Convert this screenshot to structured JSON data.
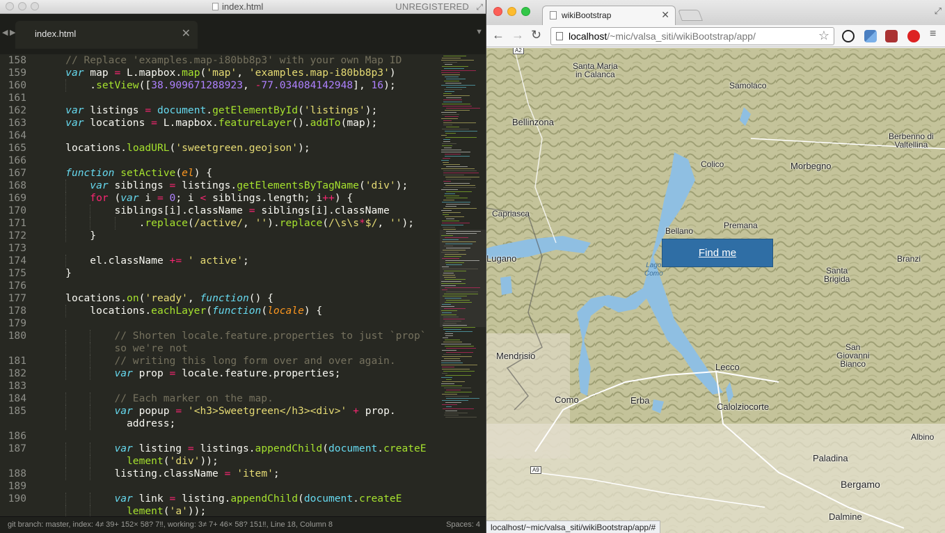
{
  "editor": {
    "window_title": "index.html",
    "unregistered": "UNREGISTERED",
    "tab_label": "index.html",
    "status": "git branch: master, index: 4≠ 39+ 152× 58? 7‼, working: 3≠ 7+ 46× 58? 151‼, Line 18, Column 8",
    "spaces": "Spaces: 4",
    "lines": [
      {
        "n": "158",
        "indent": 1,
        "tokens": [
          [
            "cm",
            "// Replace 'examples.map-i80bb8p3' with your own Map ID"
          ]
        ]
      },
      {
        "n": "159",
        "indent": 1,
        "tokens": [
          [
            "kw",
            "var"
          ],
          [
            "p",
            " map "
          ],
          [
            "op",
            "="
          ],
          [
            "p",
            " L.mapbox."
          ],
          [
            "fn",
            "map"
          ],
          [
            "p",
            "("
          ],
          [
            "str",
            "'map'"
          ],
          [
            "p",
            ", "
          ],
          [
            "str",
            "'examples.map-i80bb8p3'"
          ],
          [
            "p",
            ")"
          ]
        ]
      },
      {
        "n": "160",
        "indent": 2,
        "tokens": [
          [
            "p",
            "."
          ],
          [
            "fn",
            "setView"
          ],
          [
            "p",
            "(["
          ],
          [
            "num",
            "38.909671288923"
          ],
          [
            "p",
            ", "
          ],
          [
            "op",
            "-"
          ],
          [
            "num",
            "77.034084142948"
          ],
          [
            "p",
            "], "
          ],
          [
            "num",
            "16"
          ],
          [
            "p",
            ");"
          ]
        ]
      },
      {
        "n": "161",
        "indent": 0,
        "tokens": []
      },
      {
        "n": "162",
        "indent": 1,
        "tokens": [
          [
            "kw",
            "var"
          ],
          [
            "p",
            " listings "
          ],
          [
            "op",
            "="
          ],
          [
            "p",
            " "
          ],
          [
            "dom",
            "document"
          ],
          [
            "p",
            "."
          ],
          [
            "fn",
            "getElementById"
          ],
          [
            "p",
            "("
          ],
          [
            "str",
            "'listings'"
          ],
          [
            "p",
            ");"
          ]
        ]
      },
      {
        "n": "163",
        "indent": 1,
        "tokens": [
          [
            "kw",
            "var"
          ],
          [
            "p",
            " locations "
          ],
          [
            "op",
            "="
          ],
          [
            "p",
            " L.mapbox."
          ],
          [
            "fn",
            "featureLayer"
          ],
          [
            "p",
            "()."
          ],
          [
            "fn",
            "addTo"
          ],
          [
            "p",
            "(map);"
          ]
        ]
      },
      {
        "n": "164",
        "indent": 0,
        "tokens": []
      },
      {
        "n": "165",
        "indent": 1,
        "tokens": [
          [
            "p",
            "locations."
          ],
          [
            "fn",
            "loadURL"
          ],
          [
            "p",
            "("
          ],
          [
            "str",
            "'sweetgreen.geojson'"
          ],
          [
            "p",
            ");"
          ]
        ]
      },
      {
        "n": "166",
        "indent": 0,
        "tokens": []
      },
      {
        "n": "167",
        "indent": 1,
        "tokens": [
          [
            "kw",
            "function"
          ],
          [
            "p",
            " "
          ],
          [
            "fn",
            "setActive"
          ],
          [
            "p",
            "("
          ],
          [
            "par",
            "el"
          ],
          [
            "p",
            ") {"
          ]
        ]
      },
      {
        "n": "168",
        "indent": 2,
        "tokens": [
          [
            "kw",
            "var"
          ],
          [
            "p",
            " siblings "
          ],
          [
            "op",
            "="
          ],
          [
            "p",
            " listings."
          ],
          [
            "fn",
            "getElementsByTagName"
          ],
          [
            "p",
            "("
          ],
          [
            "str",
            "'div'"
          ],
          [
            "p",
            ");"
          ]
        ]
      },
      {
        "n": "169",
        "indent": 2,
        "tokens": [
          [
            "ctl",
            "for"
          ],
          [
            "p",
            " ("
          ],
          [
            "kw",
            "var"
          ],
          [
            "p",
            " i "
          ],
          [
            "op",
            "="
          ],
          [
            "p",
            " "
          ],
          [
            "num",
            "0"
          ],
          [
            "p",
            "; i "
          ],
          [
            "op",
            "<"
          ],
          [
            "p",
            " siblings.length; i"
          ],
          [
            "op",
            "++"
          ],
          [
            "p",
            ") {"
          ]
        ]
      },
      {
        "n": "170",
        "indent": 3,
        "tokens": [
          [
            "p",
            "siblings[i].className "
          ],
          [
            "op",
            "="
          ],
          [
            "p",
            " siblings[i].className"
          ]
        ]
      },
      {
        "n": "171",
        "indent": 4,
        "tokens": [
          [
            "p",
            "."
          ],
          [
            "fn",
            "replace"
          ],
          [
            "p",
            "("
          ],
          [
            "str",
            "/active/"
          ],
          [
            "p",
            ", "
          ],
          [
            "str",
            "''"
          ],
          [
            "p",
            ")."
          ],
          [
            "fn",
            "replace"
          ],
          [
            "p",
            "("
          ],
          [
            "str",
            "/\\s\\s"
          ],
          [
            "op",
            "*"
          ],
          [
            "str",
            "$/"
          ],
          [
            "p",
            ", "
          ],
          [
            "str",
            "''"
          ],
          [
            "p",
            ");"
          ]
        ]
      },
      {
        "n": "172",
        "indent": 2,
        "tokens": [
          [
            "p",
            "}"
          ]
        ]
      },
      {
        "n": "173",
        "indent": 0,
        "tokens": []
      },
      {
        "n": "174",
        "indent": 2,
        "tokens": [
          [
            "p",
            "el.className "
          ],
          [
            "op",
            "+="
          ],
          [
            "p",
            " "
          ],
          [
            "str",
            "' active'"
          ],
          [
            "p",
            ";"
          ]
        ]
      },
      {
        "n": "175",
        "indent": 1,
        "tokens": [
          [
            "p",
            "}"
          ]
        ]
      },
      {
        "n": "176",
        "indent": 0,
        "tokens": []
      },
      {
        "n": "177",
        "indent": 1,
        "tokens": [
          [
            "p",
            "locations."
          ],
          [
            "fn",
            "on"
          ],
          [
            "p",
            "("
          ],
          [
            "str",
            "'ready'"
          ],
          [
            "p",
            ", "
          ],
          [
            "kw",
            "function"
          ],
          [
            "p",
            "() {"
          ]
        ]
      },
      {
        "n": "178",
        "indent": 2,
        "tokens": [
          [
            "p",
            "locations."
          ],
          [
            "fn",
            "eachLayer"
          ],
          [
            "p",
            "("
          ],
          [
            "kw",
            "function"
          ],
          [
            "p",
            "("
          ],
          [
            "par",
            "locale"
          ],
          [
            "p",
            ") {"
          ]
        ]
      },
      {
        "n": "179",
        "indent": 0,
        "tokens": []
      },
      {
        "n": "180",
        "indent": 3,
        "tokens": [
          [
            "cm",
            "// Shorten locale.feature.properties to just `prop`"
          ]
        ]
      },
      {
        "n": "",
        "indent": 3,
        "tokens": [
          [
            "cm",
            "so we're not"
          ]
        ]
      },
      {
        "n": "181",
        "indent": 3,
        "tokens": [
          [
            "cm",
            "// writing this long form over and over again."
          ]
        ]
      },
      {
        "n": "182",
        "indent": 3,
        "tokens": [
          [
            "kw",
            "var"
          ],
          [
            "p",
            " prop "
          ],
          [
            "op",
            "="
          ],
          [
            "p",
            " locale.feature.properties;"
          ]
        ]
      },
      {
        "n": "183",
        "indent": 0,
        "tokens": []
      },
      {
        "n": "184",
        "indent": 3,
        "tokens": [
          [
            "cm",
            "// Each marker on the map."
          ]
        ]
      },
      {
        "n": "185",
        "indent": 3,
        "tokens": [
          [
            "kw",
            "var"
          ],
          [
            "p",
            " popup "
          ],
          [
            "op",
            "="
          ],
          [
            "p",
            " "
          ],
          [
            "str",
            "'<h3>Sweetgreen</h3><div>'"
          ],
          [
            "p",
            " "
          ],
          [
            "op",
            "+"
          ],
          [
            "p",
            " prop."
          ]
        ]
      },
      {
        "n": "",
        "indent": 3,
        "extra": 2,
        "tokens": [
          [
            "p",
            "address;"
          ]
        ]
      },
      {
        "n": "186",
        "indent": 0,
        "tokens": []
      },
      {
        "n": "187",
        "indent": 3,
        "tokens": [
          [
            "kw",
            "var"
          ],
          [
            "p",
            " listing "
          ],
          [
            "op",
            "="
          ],
          [
            "p",
            " listings."
          ],
          [
            "fn",
            "appendChild"
          ],
          [
            "p",
            "("
          ],
          [
            "dom",
            "document"
          ],
          [
            "p",
            "."
          ],
          [
            "fn",
            "createE"
          ]
        ]
      },
      {
        "n": "",
        "indent": 3,
        "extra": 2,
        "tokens": [
          [
            "fn",
            "lement"
          ],
          [
            "p",
            "("
          ],
          [
            "str",
            "'div'"
          ],
          [
            "p",
            "));"
          ]
        ]
      },
      {
        "n": "188",
        "indent": 3,
        "tokens": [
          [
            "p",
            "listing.className "
          ],
          [
            "op",
            "="
          ],
          [
            "p",
            " "
          ],
          [
            "str",
            "'item'"
          ],
          [
            "p",
            ";"
          ]
        ]
      },
      {
        "n": "189",
        "indent": 0,
        "tokens": []
      },
      {
        "n": "190",
        "indent": 3,
        "tokens": [
          [
            "kw",
            "var"
          ],
          [
            "p",
            " link "
          ],
          [
            "op",
            "="
          ],
          [
            "p",
            " listing."
          ],
          [
            "fn",
            "appendChild"
          ],
          [
            "p",
            "("
          ],
          [
            "dom",
            "document"
          ],
          [
            "p",
            "."
          ],
          [
            "fn",
            "createE"
          ]
        ]
      },
      {
        "n": "",
        "indent": 3,
        "extra": 2,
        "tokens": [
          [
            "fn",
            "lement"
          ],
          [
            "p",
            "("
          ],
          [
            "str",
            "'a'"
          ],
          [
            "p",
            "));"
          ]
        ]
      }
    ]
  },
  "browser": {
    "tab_title": "wikiBootstrap",
    "url_host": "localhost",
    "url_path": "/~mic/valsa_siti/wikiBootstrap/app/",
    "status_url": "localhost/~mic/valsa_siti/wikiBootstrap/app/#",
    "find_me": "Find me",
    "map_labels": [
      {
        "text": "Santa Maria in Calanca",
        "cls": ""
      },
      {
        "text": "Samolaco",
        "cls": ""
      },
      {
        "text": "Bellinzona",
        "cls": "big"
      },
      {
        "text": "Berbenno di Valtellina",
        "cls": ""
      },
      {
        "text": "Colico",
        "cls": ""
      },
      {
        "text": "Morbegno",
        "cls": "big"
      },
      {
        "text": "Capriasca",
        "cls": ""
      },
      {
        "text": "Bellano",
        "cls": ""
      },
      {
        "text": "Premana",
        "cls": ""
      },
      {
        "text": "Lugano",
        "cls": "big"
      },
      {
        "text": "Lago Como",
        "cls": "lake"
      },
      {
        "text": "Santa Brigida",
        "cls": ""
      },
      {
        "text": "Branzi",
        "cls": ""
      },
      {
        "text": "Mendrisio",
        "cls": "big"
      },
      {
        "text": "San Giovanni Bianco",
        "cls": ""
      },
      {
        "text": "Lecco",
        "cls": "big"
      },
      {
        "text": "Como",
        "cls": "big"
      },
      {
        "text": "Erba",
        "cls": "big"
      },
      {
        "text": "Calolziocorte",
        "cls": "big"
      },
      {
        "text": "Albino",
        "cls": ""
      },
      {
        "text": "Paladina",
        "cls": "big"
      },
      {
        "text": "Bergamo",
        "cls": "city"
      },
      {
        "text": "Dalmine",
        "cls": "big"
      }
    ],
    "road_shields": [
      "A2",
      "A9"
    ]
  }
}
